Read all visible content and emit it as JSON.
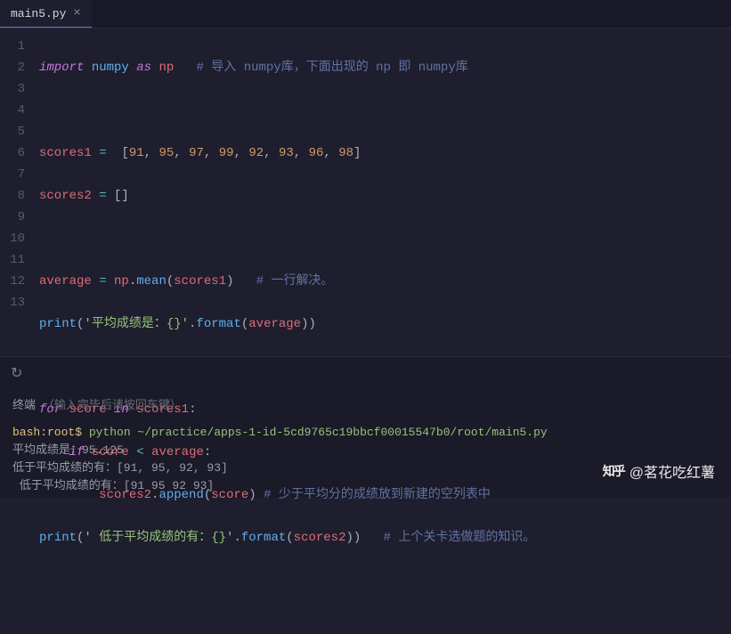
{
  "tab": {
    "filename": "main5.py",
    "close": "×"
  },
  "gutter": [
    "1",
    "2",
    "3",
    "4",
    "5",
    "6",
    "7",
    "8",
    "9",
    "10",
    "11",
    "12",
    "13"
  ],
  "code": {
    "l1": {
      "import": "import",
      "numpy": "numpy",
      "as": "as",
      "np": "np",
      "comment": "# 导入 numpy库，下面出现的 np 即 numpy库"
    },
    "l3": {
      "var": "scores1",
      "eq": "=",
      "vals": [
        "91",
        "95",
        "97",
        "99",
        "92",
        "93",
        "96",
        "98"
      ]
    },
    "l4": {
      "var": "scores2",
      "eq": "=",
      "empty": "[]"
    },
    "l6": {
      "var": "average",
      "eq": "=",
      "np": "np",
      "mean": "mean",
      "arg": "scores1",
      "comment": "# 一行解决。"
    },
    "l7": {
      "print": "print",
      "str": "'平均成绩是：{}'",
      "format": "format",
      "arg": "average"
    },
    "l9": {
      "for": "for",
      "score": "score",
      "in": "in",
      "scores1": "scores1"
    },
    "l10": {
      "if": "if",
      "score": "score",
      "lt": "<",
      "average": "average"
    },
    "l11": {
      "scores2": "scores2",
      "append": "append",
      "score": "score",
      "comment": "# 少于平均分的成绩放到新建的空列表中"
    },
    "l12": {
      "print": "print",
      "str": "' 低于平均成绩的有：{}'",
      "format": "format",
      "arg": "scores2",
      "comment": "# 上个关卡选做题的知识。"
    }
  },
  "terminal": {
    "label": "终端",
    "hint": "（输入完毕后请按回车键）",
    "prompt_user": "bash:root$",
    "cmd": "python ~/practice/apps-1-id-5cd9765c19bbcf00015547b0/root/main5.py",
    "out1": "平均成绩是：95.125",
    "out2": "低于平均成绩的有：[91, 95, 92, 93]",
    "out3": " 低于平均成绩的有：[91 95 92 93]"
  },
  "watermark": {
    "logo": "知乎",
    "text": "@茗花吃红薯"
  }
}
